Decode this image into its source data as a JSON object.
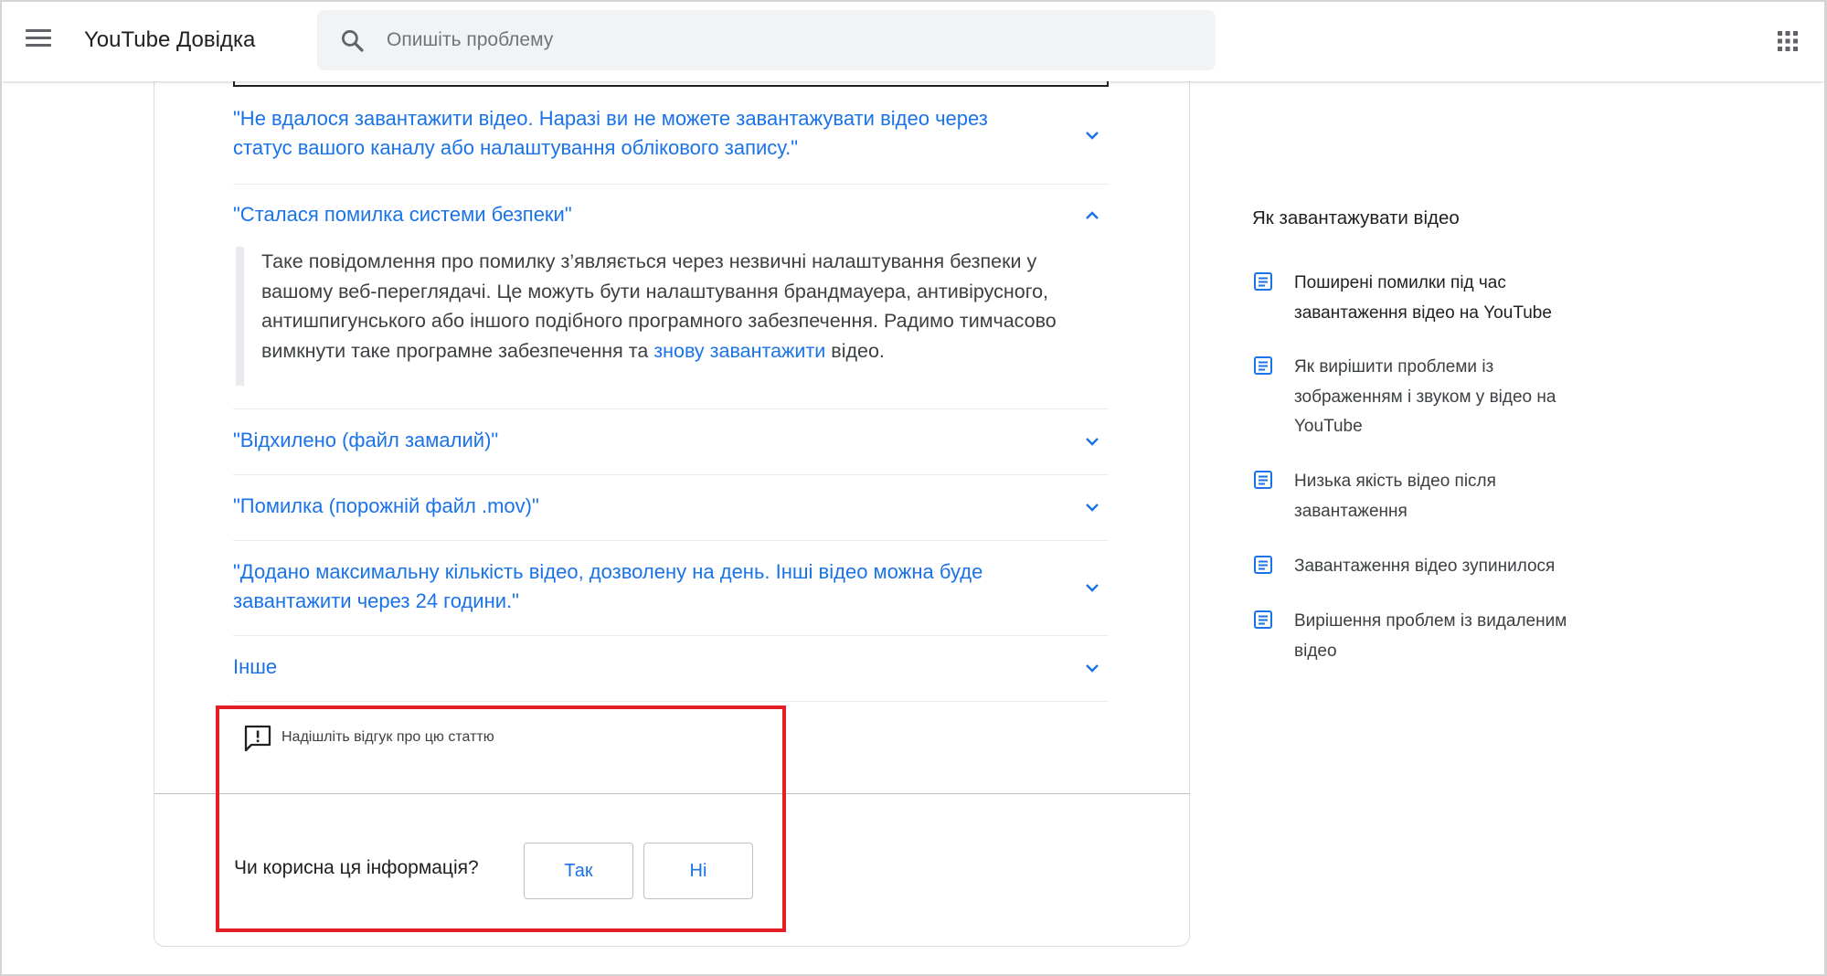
{
  "header": {
    "title": "YouTube Довідка",
    "search_placeholder": "Опишіть проблему"
  },
  "article": {
    "accordion": [
      {
        "title": "\"Не вдалося завантажити відео. Наразі ви не можете завантажувати відео через статус вашого каналу або налаштування облікового запису.\"",
        "expanded": false
      },
      {
        "title": "\"Сталася помилка системи безпеки\"",
        "expanded": true
      },
      {
        "title": "\"Відхилено (файл замалий)\"",
        "expanded": false
      },
      {
        "title": "\"Помилка (порожній файл .mov)\"",
        "expanded": false
      },
      {
        "title": "\"Додано максимальну кількість відео, дозволену на день. Інші відео можна буде завантажити через 24 години.\"",
        "expanded": false
      },
      {
        "title": "Інше",
        "expanded": false
      }
    ],
    "expanded_body": {
      "text_before": "Таке повідомлення про помилку з’являється через незвичні налаштування безпеки у вашому веб-переглядачі. Це можуть бути налаштування брандмауера, антивірусного, антишпигунського або іншого подібного програмного забезпечення. Радимо тимчасово вимкнути таке програмне забезпечення та ",
      "link": "знову завантажити",
      "text_after": " відео."
    },
    "feedback_link": "Надішліть відгук про цю статтю",
    "helpful_question": "Чи корисна ця інформація?",
    "yes_label": "Так",
    "no_label": "Ні"
  },
  "sidebar": {
    "title": "Як завантажувати відео",
    "items": [
      {
        "label": "Поширені помилки під час завантаження відео на YouTube",
        "active": true
      },
      {
        "label": "Як вирішити проблеми із зображенням і звуком у відео на YouTube",
        "active": false
      },
      {
        "label": "Низька якість відео після завантаження",
        "active": false
      },
      {
        "label": "Завантаження відео зупинилося",
        "active": false
      },
      {
        "label": "Вирішення проблем із видаленим відео",
        "active": false
      }
    ]
  },
  "colors": {
    "link": "#1a73e8",
    "highlight": "#e31e24",
    "search_bg": "#f1f3f4"
  }
}
